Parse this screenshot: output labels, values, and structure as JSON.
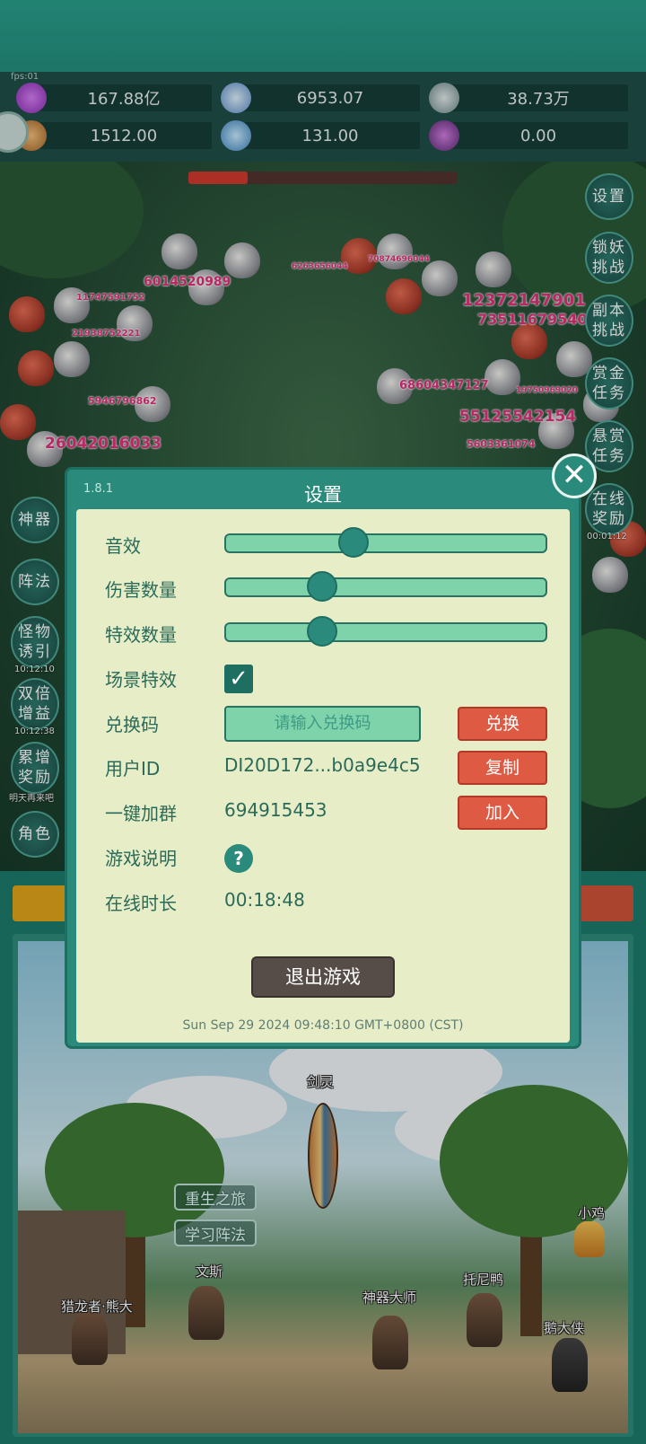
{
  "hud": {
    "fps_text": "fps:01",
    "resources": [
      {
        "icon": "purple-gem-icon",
        "value": "167.88亿"
      },
      {
        "icon": "blue-crystal-icon",
        "value": "6953.07"
      },
      {
        "icon": "silver-orb-icon",
        "value": "38.73万"
      },
      {
        "icon": "bread-icon",
        "value": "1512.00"
      },
      {
        "icon": "ice-shard-icon",
        "value": "131.00"
      },
      {
        "icon": "purple-pouch-icon",
        "value": "0.00"
      }
    ]
  },
  "battle": {
    "boss_hp_fraction": 0.22,
    "damage_numbers": [
      "6014520989",
      "12372147901",
      "73511679540",
      "11747591752",
      "21938752221",
      "5946796862",
      "68604347127",
      "55125542154",
      "26042016033",
      "6263656044",
      "5603361074",
      "19750969020",
      "70874696044"
    ]
  },
  "side_buttons_right": [
    {
      "label": "设置"
    },
    {
      "label": "锁妖挑战"
    },
    {
      "label": "副本挑战"
    },
    {
      "label": "赏金任务"
    },
    {
      "label": "悬赏任务"
    },
    {
      "label": "在线奖励",
      "timer": "00:01:12"
    }
  ],
  "side_buttons_left": [
    {
      "label": "神器"
    },
    {
      "label": "阵法"
    },
    {
      "label": "怪物诱引",
      "timer": "10:12:10"
    },
    {
      "label": "双倍增益",
      "timer": "10:12:38"
    },
    {
      "label": "累增奖励",
      "timer": "明天再来吧"
    },
    {
      "label": "角色"
    }
  ],
  "scene": {
    "npcs": [
      {
        "label": "剑灵"
      },
      {
        "label": "小鸡"
      },
      {
        "label": "文斯"
      },
      {
        "label": "托尼鸭"
      },
      {
        "label": "猎龙者·熊大"
      },
      {
        "label": "神器大师"
      },
      {
        "label": "鹅大侠"
      }
    ],
    "buttons": [
      {
        "label": "重生之旅"
      },
      {
        "label": "学习阵法"
      }
    ]
  },
  "settings": {
    "version": "1.8.1",
    "title": "设置",
    "sound_label": "音效",
    "sound_level": 0.4,
    "damage_count_label": "伤害数量",
    "damage_count_level": 0.3,
    "effect_count_label": "特效数量",
    "effect_count_level": 0.3,
    "scene_effect_label": "场景特效",
    "scene_effect_checked": true,
    "redeem_label": "兑换码",
    "redeem_placeholder": "请输入兑换码",
    "redeem_button": "兑换",
    "user_id_label": "用户ID",
    "user_id_value": "DI20D172...b0a9e4c5",
    "copy_button": "复制",
    "join_group_label": "一键加群",
    "join_group_value": "694915453",
    "join_button": "加入",
    "game_help_label": "游戏说明",
    "online_time_label": "在线时长",
    "online_time_value": "00:18:48",
    "exit_button": "退出游戏",
    "datetime": "Sun Sep 29 2024 09:48:10 GMT+0800 (CST)"
  },
  "colors": {
    "panel_bg": "#e7edc7",
    "accent_teal": "#2a8a7b",
    "button_red": "#df5a43",
    "damage_pink": "#e2307a"
  }
}
